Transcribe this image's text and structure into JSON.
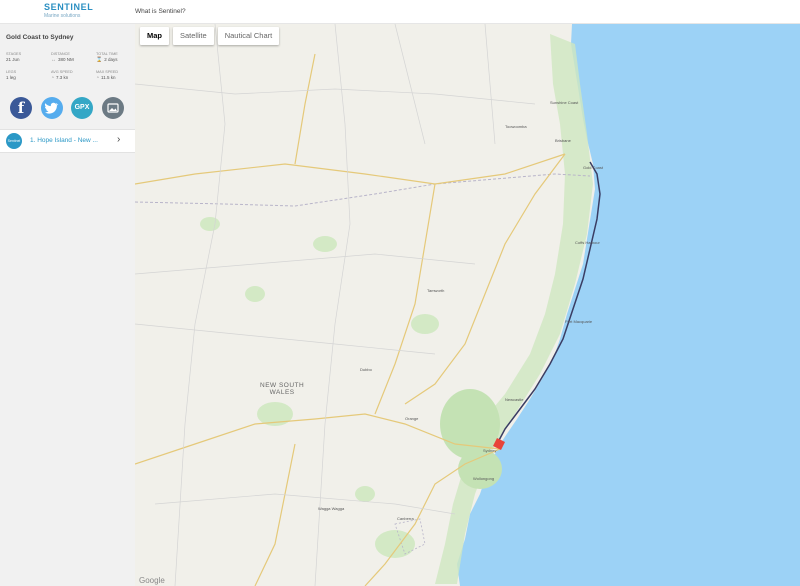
{
  "header": {
    "logo_title": "SENTINEL",
    "logo_subtitle": "Marine solutions",
    "what_link": "What is Sentinel?"
  },
  "sidebar": {
    "trip_title": "Gold Coast to Sydney",
    "stats": [
      {
        "label": "Stages",
        "value": "21 Jun"
      },
      {
        "label": "Distance",
        "value": "380 NM"
      },
      {
        "label": "Total time",
        "value": "2 days"
      },
      {
        "label": "Legs",
        "value": "1 leg"
      },
      {
        "label": "Avg speed",
        "value": "7.3 kn"
      },
      {
        "label": "Max speed",
        "value": "11.5 kn"
      }
    ],
    "share_buttons": [
      {
        "name": "facebook",
        "glyph": "f",
        "color": "#3b5998"
      },
      {
        "name": "twitter",
        "glyph": "🐦",
        "color": "#55acee"
      },
      {
        "name": "gpx",
        "glyph": "GPX",
        "color": "#34a7c6"
      },
      {
        "name": "image",
        "glyph": "▣",
        "color": "#6c7a84"
      }
    ],
    "leg": {
      "badge": "Sentinel",
      "label": "1. Hope Island - New ...",
      "chevron": "›"
    }
  },
  "map": {
    "controls": [
      {
        "label": "Map",
        "active": true
      },
      {
        "label": "Satellite",
        "active": false
      },
      {
        "label": "Nautical Chart",
        "active": false
      }
    ],
    "labels": {
      "region": "NEW SOUTH\nWALES",
      "brisbane": "Brisbane",
      "gold_coast": "Gold Coast",
      "sunshine_coast": "Sunshine Coast",
      "newcastle": "Newcastle",
      "sydney": "Sydney",
      "canberra": "Canberra",
      "dubbo": "Dubbo",
      "tamworth": "Tamworth",
      "wagga": "Wagga Wagga",
      "orange": "Orange",
      "toowoomba": "Toowoomba",
      "port_macquarie": "Port Macquarie",
      "coffs": "Coffs Harbour",
      "wollongong": "Wollongong",
      "google": "Google"
    },
    "colors": {
      "land": "#f1f0ea",
      "water": "#9cd2f6",
      "green": "#cfe7c0",
      "route": "#3a3d63",
      "marker": "#e8443a"
    }
  }
}
